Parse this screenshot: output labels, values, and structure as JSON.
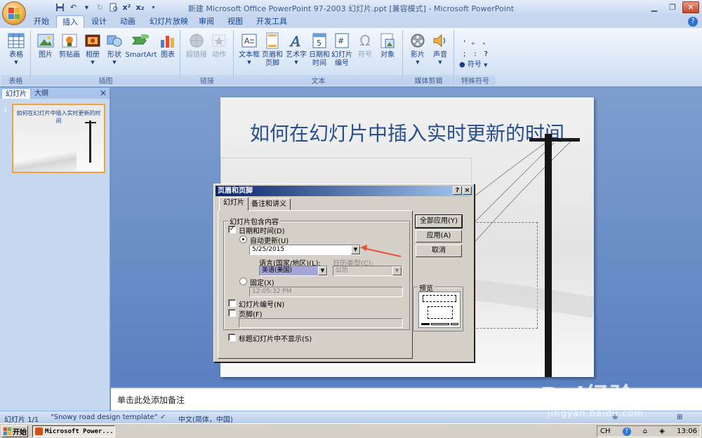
{
  "window": {
    "title": "新建 Microsoft Office PowerPoint 97-2003 幻灯片.ppt [兼容模式] - Microsoft PowerPoint"
  },
  "tabs": [
    {
      "label": "开始"
    },
    {
      "label": "插入"
    },
    {
      "label": "设计"
    },
    {
      "label": "动画"
    },
    {
      "label": "幻灯片放映"
    },
    {
      "label": "审阅"
    },
    {
      "label": "视图"
    },
    {
      "label": "开发工具"
    }
  ],
  "ribbon": {
    "groups": {
      "table": "表格",
      "illustrations": "插图",
      "links": "链接",
      "text": "文本",
      "media": "媒体剪辑",
      "symbols": "特殊符号"
    },
    "buttons": {
      "table": "表格",
      "picture": "图片",
      "clipart": "剪贴画",
      "album": "相册",
      "shapes": "形状",
      "smartart": "SmartArt",
      "chart": "图表",
      "hyperlink": "超链接",
      "action": "动作",
      "textbox": "文本框",
      "header_footer_1": "页眉和",
      "header_footer_2": "页脚",
      "wordart": "艺术字",
      "datetime_1": "日期和",
      "datetime_2": "时间",
      "slidenum_1": "幻灯片",
      "slidenum_2": "编号",
      "symbol": "符号",
      "object": "对象",
      "movie": "影片",
      "sound": "声音",
      "special_symbol": "符号"
    },
    "symbols_grid": [
      ",",
      "。",
      "、",
      ";",
      ":",
      "?"
    ]
  },
  "left_pane": {
    "tab_slides": "幻灯片",
    "tab_outline": "大纲",
    "thumb_number": "1",
    "thumb_title": "如何在幻灯片中插入实时更新的时间"
  },
  "slide": {
    "title": "如何在幻灯片中插入实时更新的时间"
  },
  "notes": {
    "placeholder": "单击此处添加备注"
  },
  "status": {
    "slide_pos": "幻灯片 1/1",
    "template": "\"Snowy road design template\"",
    "language": "中文(简体，中国)"
  },
  "taskbar": {
    "start": "开始",
    "app": "Microsoft Power...",
    "ime": "CH",
    "time": "13:06"
  },
  "dialog": {
    "title": "页眉和页脚",
    "tab_slide": "幻灯片",
    "tab_notes": "备注和讲义",
    "group_label": "幻灯片包含内容",
    "datetime_label": "日期和时间(D)",
    "datetime_checked": true,
    "auto_update_label": "自动更新(U)",
    "auto_update_selected": true,
    "date_value": "5/25/2015",
    "language_label": "语言(国家/地区)(L):",
    "language_value": "英语(美国)",
    "calendar_label": "日历类型(C):",
    "calendar_value": "公历",
    "fixed_label": "固定(X)",
    "fixed_value": "12:05:32 PM",
    "slide_number_label": "幻灯片编号(N)",
    "footer_label": "页脚(F)",
    "hide_title_label": "标题幻灯片中不显示(S)",
    "btn_apply_all": "全部应用(Y)",
    "btn_apply": "应用(A)",
    "btn_cancel": "取消",
    "preview_label": "预览",
    "help_btn": "?",
    "close_btn": "×"
  },
  "watermark": {
    "text": "Bai经验",
    "sub": "jingyan.baidu.com"
  },
  "colors": {
    "accent": "#15428b",
    "dialog_title": "#0a246a",
    "arrow": "#e8503a"
  }
}
